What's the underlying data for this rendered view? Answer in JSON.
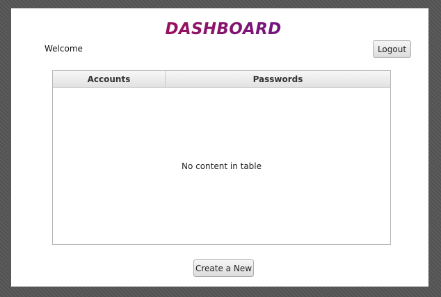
{
  "header": {
    "title": "DASHBOARD",
    "welcome": "Welcome",
    "logout_label": "Logout"
  },
  "table": {
    "columns": [
      "Accounts",
      "Passwords"
    ],
    "rows": [],
    "empty_text": "No content in table"
  },
  "actions": {
    "create_label": "Create a New"
  },
  "colors": {
    "title_gradient_start": "#d00d2d",
    "title_gradient_end": "#3b1bb0"
  }
}
